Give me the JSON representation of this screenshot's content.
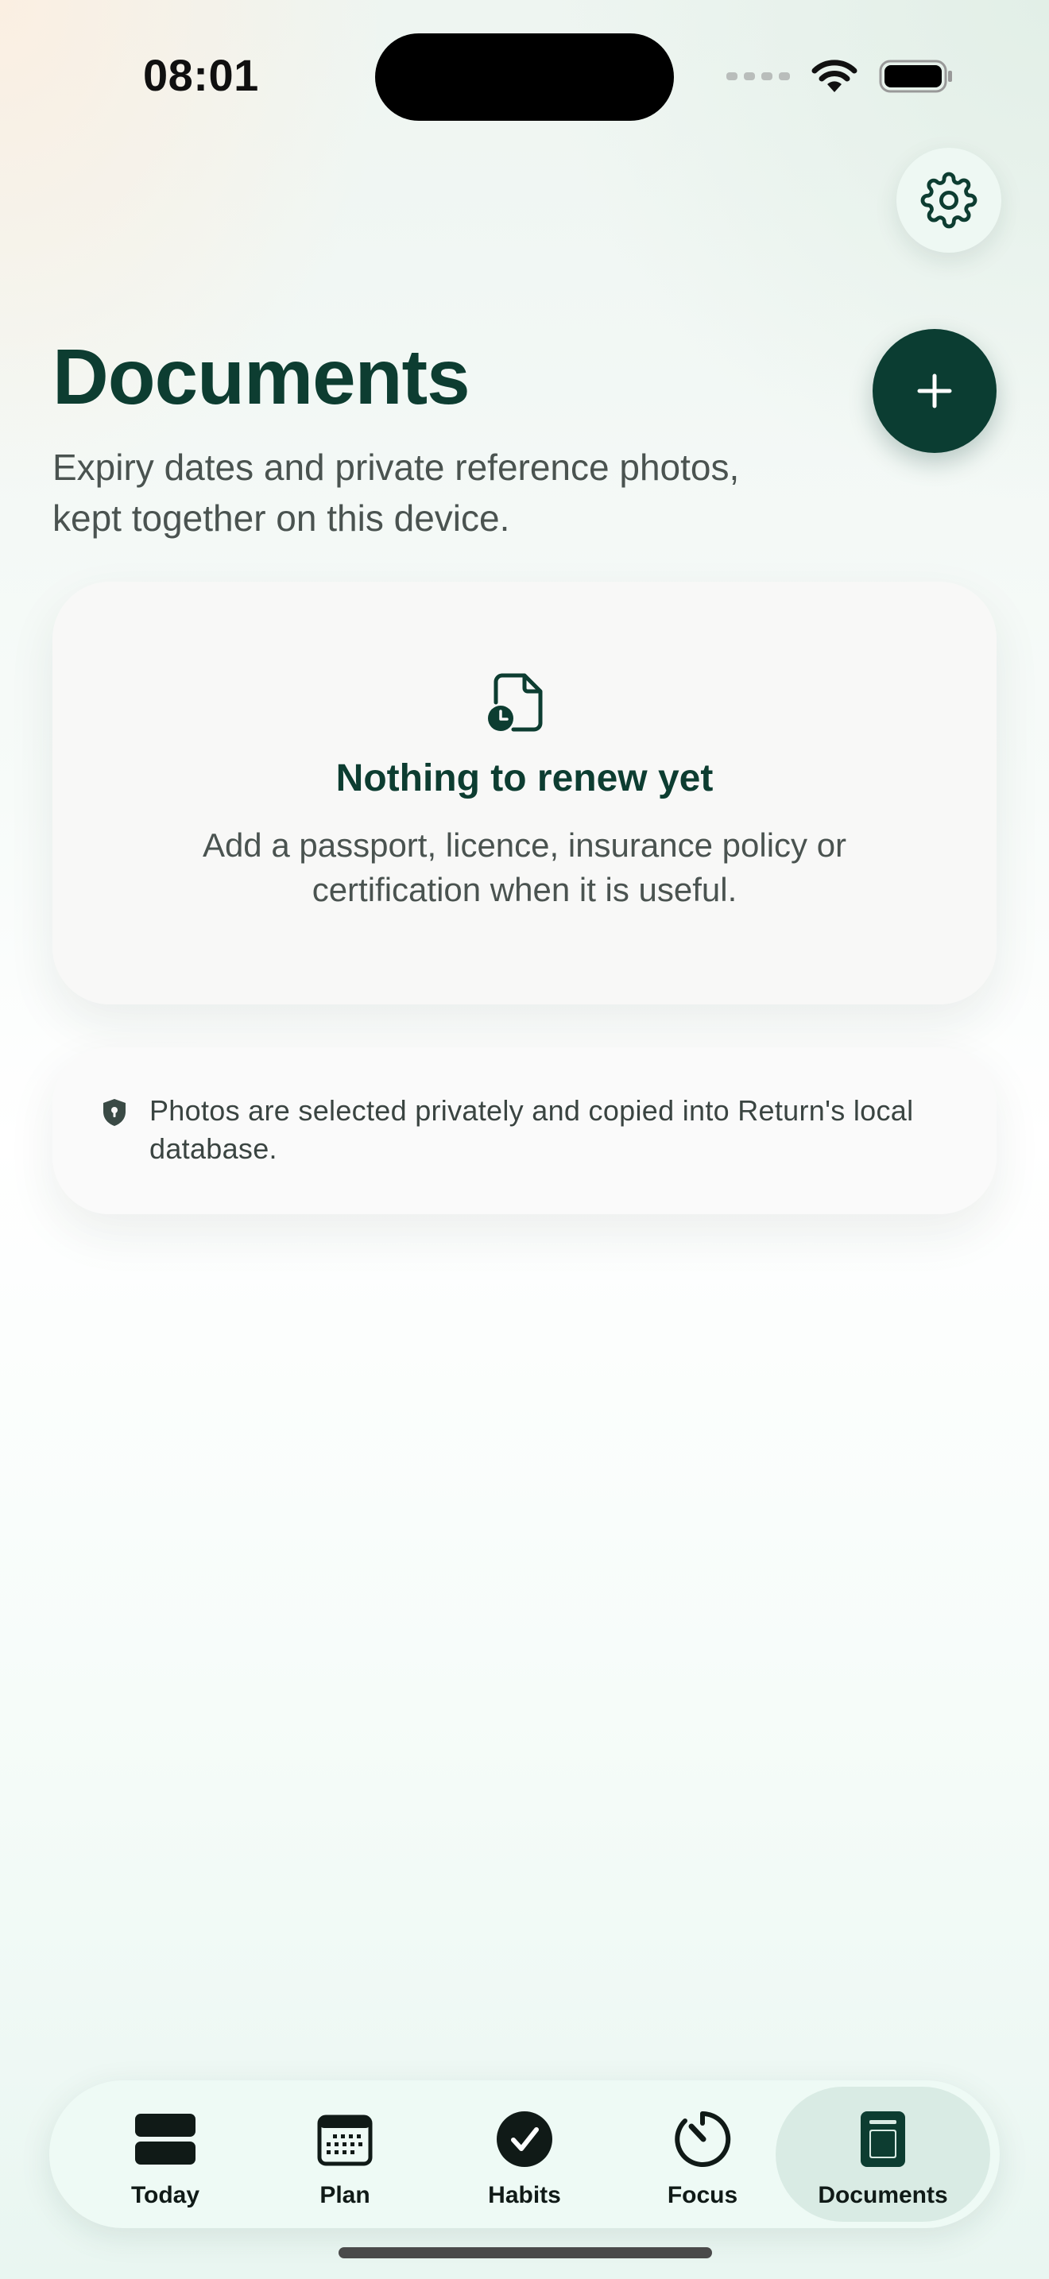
{
  "status_bar": {
    "time": "08:01"
  },
  "header": {
    "title": "Documents",
    "subtitle": "Expiry dates and private reference photos, kept together on this device."
  },
  "empty_state": {
    "icon": "document-clock-icon",
    "title": "Nothing to renew yet",
    "description": "Add a passport, licence, insurance policy or certification when it is useful."
  },
  "privacy_note": {
    "icon": "shield-lock-icon",
    "text": "Photos are selected privately and copied into Return's local database."
  },
  "actions": {
    "settings_icon": "gear-icon",
    "add_icon": "plus-icon"
  },
  "tabs": [
    {
      "label": "Today",
      "icon": "today-icon",
      "active": false
    },
    {
      "label": "Plan",
      "icon": "calendar-icon",
      "active": false
    },
    {
      "label": "Habits",
      "icon": "check-circle-icon",
      "active": false
    },
    {
      "label": "Focus",
      "icon": "timer-icon",
      "active": false
    },
    {
      "label": "Documents",
      "icon": "document-icon",
      "active": true
    }
  ],
  "colors": {
    "accent": "#0b3d32",
    "active_tab_bg": "#d9ebe4",
    "tab_bar_bg": "#eefaf5"
  }
}
